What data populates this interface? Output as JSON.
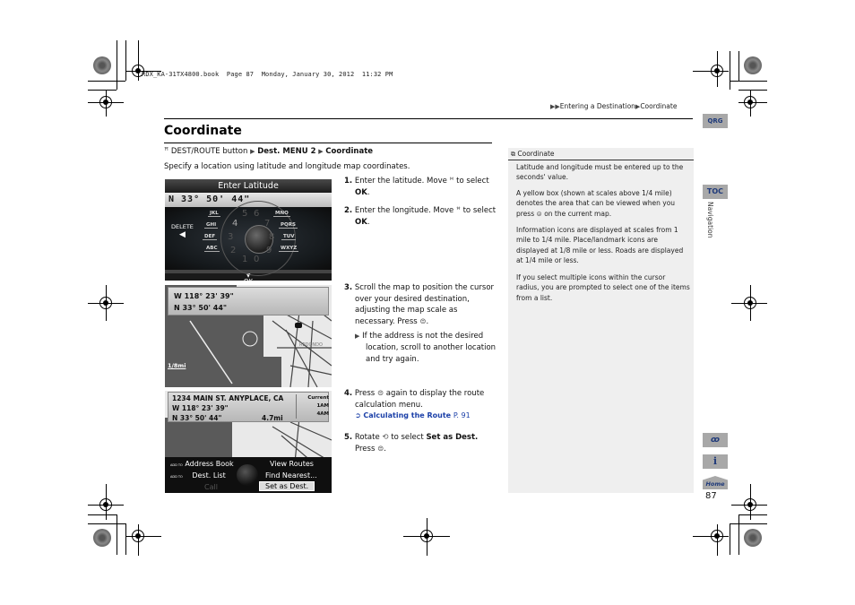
{
  "header": {
    "book_info": "RDX_KA-31TX4800.book  Page 87  Monday, January 30, 2012  11:32 PM",
    "breadcrumb": [
      "Entering a Destination",
      "Coordinate"
    ]
  },
  "section": {
    "title": "Coordinate",
    "path": {
      "button": "DEST/ROUTE button",
      "steps": [
        "Dest. MENU 2",
        "Coordinate"
      ]
    },
    "intro": "Specify a location using latitude and longitude map coordinates."
  },
  "screens": {
    "latitude": {
      "title": "Enter Latitude",
      "value": "N 33°  50'  44\"",
      "delete_label": "DELETE",
      "keys": [
        "JKL",
        "MNO",
        "GHI",
        "PQRS",
        "DEF",
        "TUV",
        "ABC",
        "WXYZ"
      ],
      "digits": [
        "5",
        "6",
        "4",
        "7",
        "3",
        "8",
        "2",
        "9",
        "1",
        "0"
      ],
      "ok_label": "OK"
    },
    "map": {
      "longitude": "W 118° 23' 39\"",
      "latitude": "N  33° 50' 44\"",
      "scale": "1/8mi",
      "place_label": "REDONDO"
    },
    "route_menu": {
      "address": "1234 MAIN ST. ANYPLACE, CA",
      "longitude": "W 118° 23' 39\"",
      "latitude": "N 33° 50' 44\"",
      "distance": "4.7mi",
      "traffic": [
        "Current",
        "1AM",
        "4AM"
      ],
      "menu_left": [
        "Address Book",
        "Dest. List",
        "Call"
      ],
      "menu_right": [
        "View Routes",
        "Find Nearest...",
        "Set as Dest."
      ],
      "add_to": "ADD TO"
    }
  },
  "steps": [
    {
      "num": "1.",
      "text_a": "Enter the latitude. Move",
      "text_b": "to select",
      "bold": "OK",
      "end": "."
    },
    {
      "num": "2.",
      "text_a": "Enter the longitude. Move",
      "text_b": "to select",
      "bold": "OK",
      "end": "."
    },
    {
      "num": "3.",
      "text": "Scroll the map to position the cursor over your desired destination, adjusting the map scale as necessary. Press",
      "end": ".",
      "note": "If the address is not the desired location, scroll to another location and try again."
    },
    {
      "num": "4.",
      "text_a": "Press",
      "text_b": "again to display the route calculation menu.",
      "link": "Calculating the Route",
      "link_page": "P. 91"
    },
    {
      "num": "5.",
      "text_a": "Rotate",
      "text_b": "to select",
      "bold": "Set as Dest.",
      "text_c": "Press",
      "end": "."
    }
  ],
  "sidebar_note": {
    "heading": "Coordinate",
    "paragraphs": [
      "Latitude and longitude must be entered up to the seconds' value.",
      "A yellow box (shown at scales above 1/4 mile) denotes the area that can be viewed when you press",
      "on the current map.",
      "Information icons are displayed at scales from 1 mile to 1/4 mile. Place/landmark icons are displayed at 1/8 mile or less. Roads are displayed at 1/4 mile or less.",
      "If you select multiple icons within the cursor radius, you are prompted to select one of the items from a list."
    ]
  },
  "right_tabs": {
    "qrg": "QRG",
    "toc": "TOC",
    "section": "Navigation",
    "home": "Home",
    "page_number": "87"
  }
}
